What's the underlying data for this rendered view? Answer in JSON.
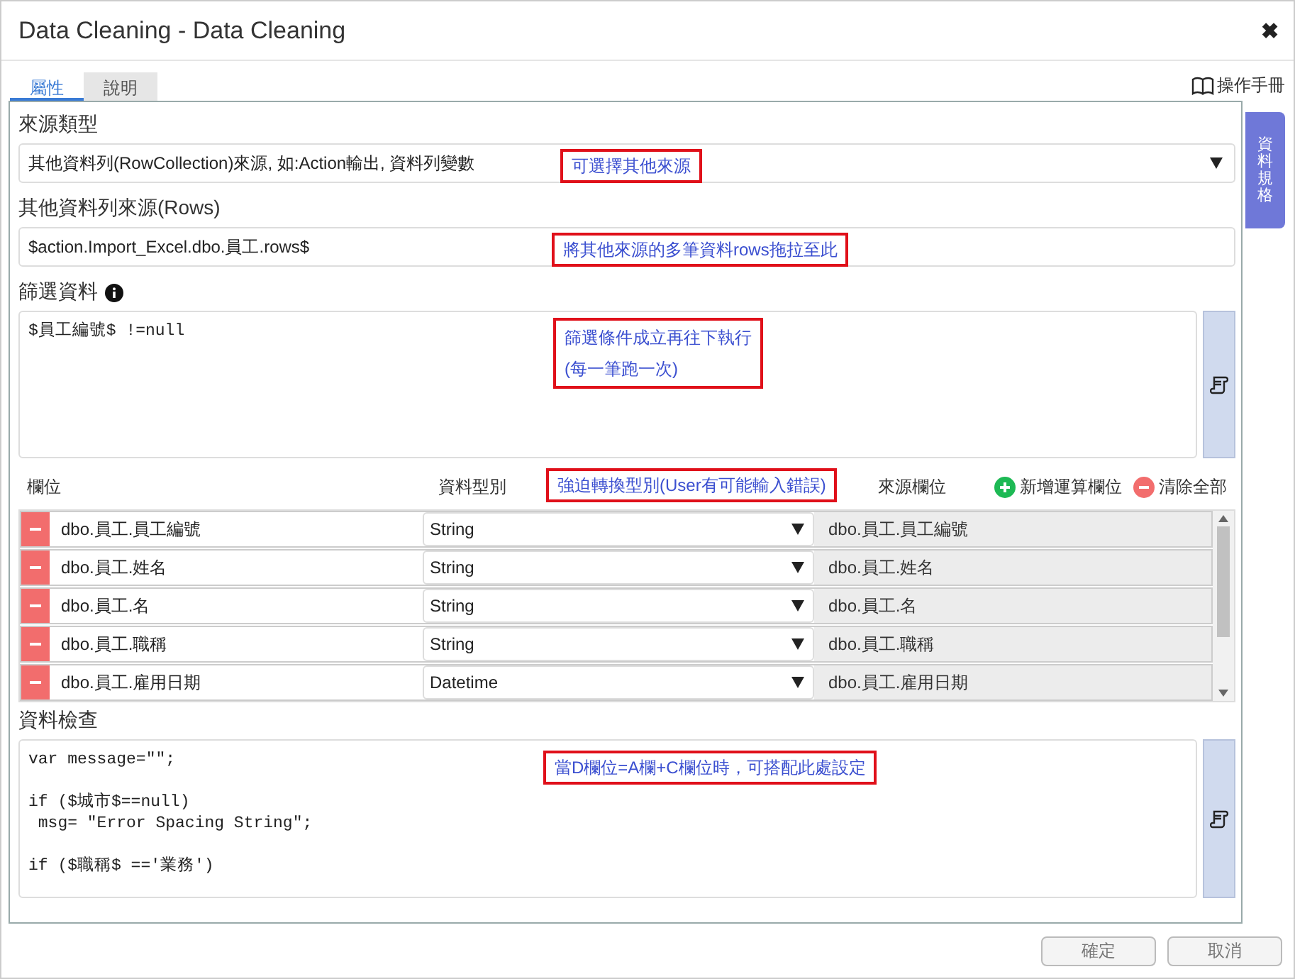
{
  "window": {
    "title": "Data Cleaning - Data Cleaning",
    "close": "✖"
  },
  "tabs": [
    {
      "label": "屬性",
      "selected": true
    },
    {
      "label": "說明",
      "selected": false
    }
  ],
  "manual_link": "操作手冊",
  "side_tab": "資料規格",
  "source_type": {
    "label": "來源類型",
    "value": "其他資料列(RowCollection)來源, 如:Action輸出, 資料列變數",
    "annotation": "可選擇其他來源"
  },
  "rows_source": {
    "label": "其他資料列來源(Rows)",
    "value": "$action.Import_Excel.dbo.員工.rows$",
    "annotation": "將其他來源的多筆資料rows拖拉至此"
  },
  "filter": {
    "label": "篩選資料",
    "code": "$員工編號$ !=null",
    "annotation": [
      "篩選條件成立再往下執行",
      "(每一筆跑一次)"
    ]
  },
  "fields": {
    "columns": [
      "欄位",
      "資料型別",
      "來源欄位"
    ],
    "annotation": "強迫轉換型別(User有可能輸入錯誤)",
    "add_button": "新增運算欄位",
    "clear_button": "清除全部",
    "rows": [
      {
        "name": "dbo.員工.員工編號",
        "type": "String",
        "source": "dbo.員工.員工編號"
      },
      {
        "name": "dbo.員工.姓名",
        "type": "String",
        "source": "dbo.員工.姓名"
      },
      {
        "name": "dbo.員工.名",
        "type": "String",
        "source": "dbo.員工.名"
      },
      {
        "name": "dbo.員工.職稱",
        "type": "String",
        "source": "dbo.員工.職稱"
      },
      {
        "name": "dbo.員工.雇用日期",
        "type": "Datetime",
        "source": "dbo.員工.雇用日期"
      }
    ]
  },
  "validation": {
    "label": "資料檢查",
    "code": "var message=\"\";\n\nif ($城市$==null)\n msg= \"Error Spacing String\";\n\nif ($職稱$ =='業務')",
    "annotation": "當D欄位=A欄+C欄位時，可搭配此處設定"
  },
  "buttons": [
    "確定",
    "取消"
  ]
}
